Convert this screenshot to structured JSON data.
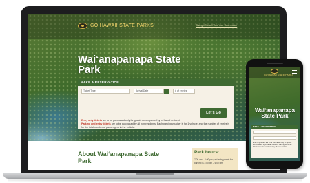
{
  "site": {
    "logo_text": "GO HAWAII STATE PARKS",
    "nav_link": "Change/Cancel/View Your Reservation"
  },
  "hero": {
    "title": "Wai‘anapanapa State Park"
  },
  "reservation": {
    "header": "MAKE A RESERVATION",
    "ticket_type": "Ticket Type",
    "date_placeholder": "Arrival Date",
    "entries": "# of entries",
    "go_button": "Let's Go",
    "note1_bold": "Entry only tickets",
    "note1_rest": " are to be purchased only for guests accompanied by a Hawaii resident.",
    "note2_bold": "Parking and entry tickets",
    "note2_rest": " are to be purchased by all non-residents. Each parking voucher is for 1 vehicle, and the number of entries is for the total number of passengers in the vehicle."
  },
  "about": {
    "title": "About Wai‘anapanapa State Park"
  },
  "hours": {
    "title": "Park hours:",
    "text": "7:00 am – 6:00 pm (last entry permit for parking is 3:00 pm – 6:00 pm)"
  },
  "phone": {
    "logo_text": "GO HAWAII STATE PARKS",
    "title": "Wai‘anapanapa State Park",
    "res_header": "MAKE A RESERVATION",
    "note": "Entry only tickets are to be purchased only for guests accompanied by a Hawaii resident. Parking and entry tickets are to be purchased by all non-residents."
  },
  "colors": {
    "brand_green": "#3f6a32",
    "accent_gold": "#f1d36b",
    "alert_red": "#c0392b",
    "panel_cream": "#f6f1e6"
  }
}
